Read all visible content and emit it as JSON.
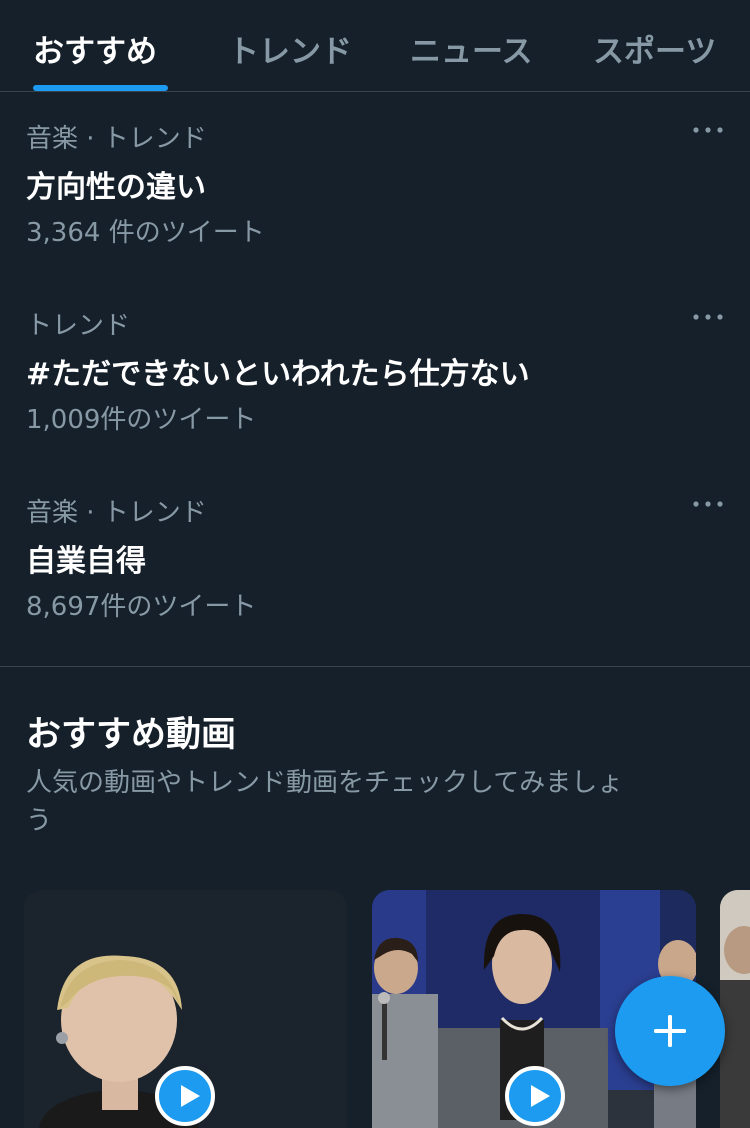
{
  "tabs": [
    {
      "label": "おすすめ",
      "active": true
    },
    {
      "label": "トレンド",
      "active": false
    },
    {
      "label": "ニュース",
      "active": false
    },
    {
      "label": "スポーツ",
      "active": false
    }
  ],
  "trends": [
    {
      "meta": "音楽 · トレンド",
      "title": "方向性の違い",
      "count": "3,364 件のツイート"
    },
    {
      "meta": "トレンド",
      "title": "#ただできないといわれたら仕方ない",
      "count": "1,009件のツイート"
    },
    {
      "meta": "音楽 · トレンド",
      "title": "自業自得",
      "count": "8,697件のツイート"
    }
  ],
  "section": {
    "title": "おすすめ動画",
    "subtitle": "人気の動画やトレンド動画をチェックしてみましょう"
  },
  "icons": {
    "more": "more-dots-icon",
    "play": "play-icon",
    "compose": "plus-icon"
  },
  "colors": {
    "background": "#15202b",
    "accent": "#1d9bf0",
    "muted_text": "#8899a6",
    "divider": "#38444d"
  }
}
